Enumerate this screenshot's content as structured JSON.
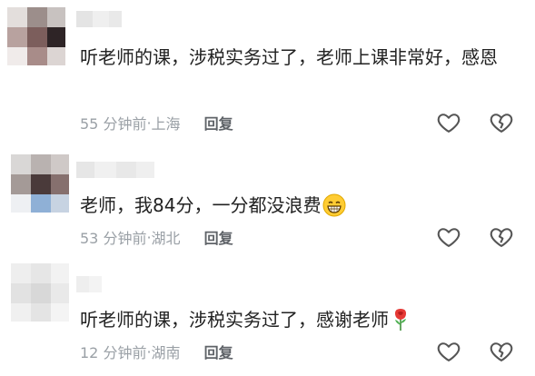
{
  "comments": [
    {
      "text": "听老师的课，涉税实务过了，老师上课非常好，感恩",
      "time": "55 分钟前",
      "sep": " · ",
      "location": "上海",
      "reply_label": "回复"
    },
    {
      "text": "老师，我84分，一分都没浪费",
      "time": "53 分钟前",
      "sep": " · ",
      "location": "湖北",
      "reply_label": "回复",
      "emoji": "grinning-face"
    },
    {
      "text": "听老师的课，涉税实务过了，感谢老师",
      "time": "12 分钟前",
      "sep": " · ",
      "location": "湖南",
      "reply_label": "回复",
      "emoji": "rose"
    }
  ],
  "icons": {
    "like": "heart-outline-icon",
    "dislike": "broken-heart-outline-icon"
  },
  "colors": {
    "text": "#222222",
    "meta": "#9aa0a6",
    "icon": "#555555"
  }
}
